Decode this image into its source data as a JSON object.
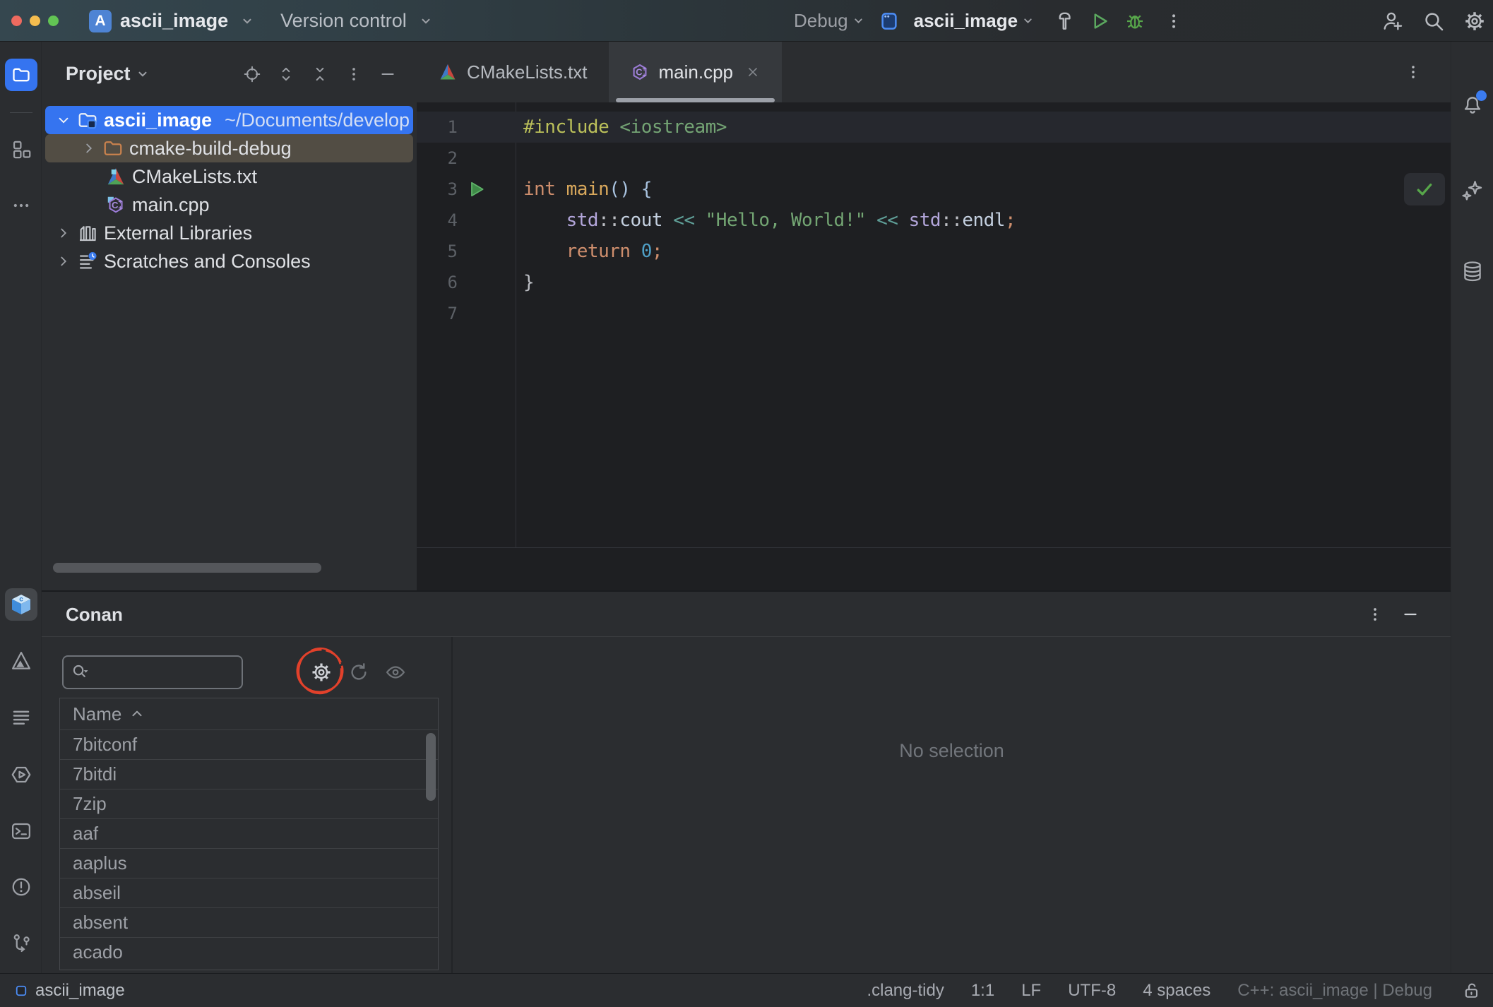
{
  "topbar": {
    "app_initial": "A",
    "project_name": "ascii_image",
    "version_control_label": "Version control",
    "run_config_label": "Debug",
    "run_target_label": "ascii_image"
  },
  "project_panel": {
    "title": "Project",
    "root": {
      "name": "ascii_image",
      "path": "~/Documents/develop"
    },
    "items": [
      {
        "label": "cmake-build-debug"
      },
      {
        "label": "CMakeLists.txt"
      },
      {
        "label": "main.cpp"
      },
      {
        "label": "External Libraries"
      },
      {
        "label": "Scratches and Consoles"
      }
    ]
  },
  "editor": {
    "tabs": [
      {
        "label": "CMakeLists.txt"
      },
      {
        "label": "main.cpp"
      }
    ],
    "code_lines": [
      {
        "n": 1,
        "current": true,
        "tokens": [
          {
            "t": "#include",
            "c": "#BBC05A"
          },
          {
            "t": " ",
            "c": "#BCBEC4"
          },
          {
            "t": "<iostream>",
            "c": "#74A474"
          }
        ]
      },
      {
        "n": 2,
        "tokens": []
      },
      {
        "n": 3,
        "run": true,
        "tokens": [
          {
            "t": "int ",
            "c": "#CE8E6D"
          },
          {
            "t": "main",
            "c": "#D9A85C"
          },
          {
            "t": "()",
            "c": "#A9C3E0"
          },
          {
            "t": " {",
            "c": "#A9C3E0"
          }
        ]
      },
      {
        "n": 4,
        "tokens": [
          {
            "t": "    ",
            "c": "#BCBEC4"
          },
          {
            "t": "std",
            "c": "#B3A6DB"
          },
          {
            "t": "::",
            "c": "#BCBEC4"
          },
          {
            "t": "cout",
            "c": "#C4D0E0"
          },
          {
            "t": " ",
            "c": "#BCBEC4"
          },
          {
            "t": "<<",
            "c": "#5F9E97"
          },
          {
            "t": " ",
            "c": "#BCBEC4"
          },
          {
            "t": "\"Hello, World!\"",
            "c": "#73A573"
          },
          {
            "t": " ",
            "c": "#BCBEC4"
          },
          {
            "t": "<<",
            "c": "#5F9E97"
          },
          {
            "t": " ",
            "c": "#BCBEC4"
          },
          {
            "t": "std",
            "c": "#B3A6DB"
          },
          {
            "t": "::",
            "c": "#BCBEC4"
          },
          {
            "t": "endl",
            "c": "#C4D0E0"
          },
          {
            "t": ";",
            "c": "#CE8E6D"
          }
        ]
      },
      {
        "n": 5,
        "tokens": [
          {
            "t": "    ",
            "c": "#BCBEC4"
          },
          {
            "t": "return ",
            "c": "#CE8E6D"
          },
          {
            "t": "0",
            "c": "#4FA0C7"
          },
          {
            "t": ";",
            "c": "#CE8E6D"
          }
        ]
      },
      {
        "n": 6,
        "tokens": [
          {
            "t": "}",
            "c": "#BCBEC4"
          }
        ]
      },
      {
        "n": 7,
        "tokens": []
      }
    ]
  },
  "conan": {
    "title": "Conan",
    "search_value": "",
    "search_placeholder": "",
    "column_header": "Name",
    "packages": [
      "7bitconf",
      "7bitdi",
      "7zip",
      "aaf",
      "aaplus",
      "abseil",
      "absent",
      "acado"
    ],
    "empty_state": "No selection"
  },
  "status_bar": {
    "project": "ascii_image",
    "items": [
      ".clang-tidy",
      "1:1",
      "LF",
      "UTF-8",
      "4 spaces"
    ],
    "context": "C++: ascii_image | Debug"
  },
  "icons": {
    "left_rail": [
      "folder-icon",
      "structure-icon",
      "more-horizontal-icon",
      "conan-cube-icon",
      "cmake-icon",
      "lines-icon",
      "services-icon",
      "terminal-icon",
      "problems-icon",
      "git-branch-icon"
    ],
    "right_rail": [
      "bell-icon",
      "ai-sparkles-icon",
      "database-icon"
    ],
    "topbar": [
      "hammer-icon",
      "run-icon",
      "debug-icon",
      "more-vertical-icon",
      "add-user-icon",
      "search-icon",
      "gear-icon"
    ]
  },
  "colors": {
    "accent_blue": "#3574F0",
    "run_green": "#57A64A",
    "annotation_red": "#E2412B",
    "editor_bg": "#1E1F22",
    "panel_bg": "#2B2D30",
    "traffic_red": "#EE6A5F",
    "traffic_yellow": "#F5BD4F",
    "traffic_green": "#62C454"
  }
}
